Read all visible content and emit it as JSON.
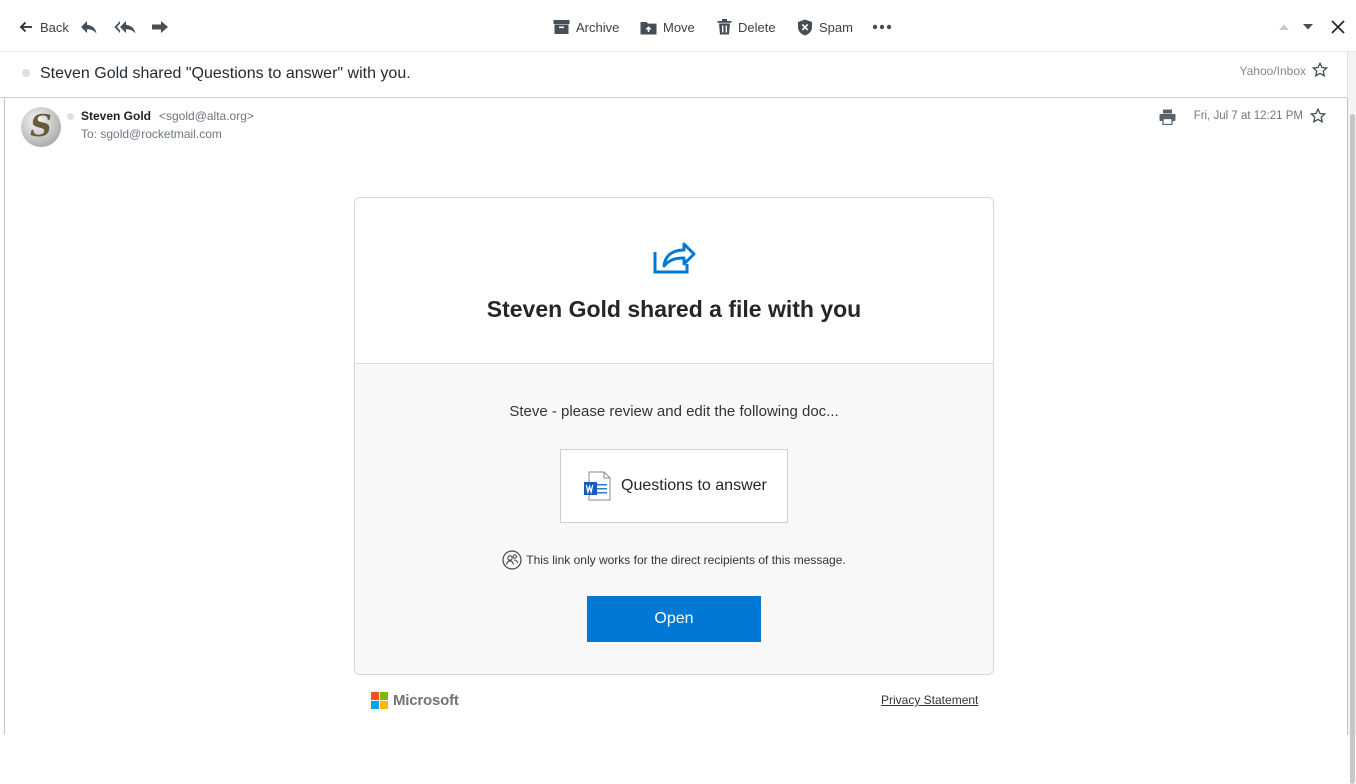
{
  "toolbar": {
    "back_label": "Back",
    "archive_label": "Archive",
    "move_label": "Move",
    "delete_label": "Delete",
    "spam_label": "Spam"
  },
  "subject": {
    "text": "Steven Gold shared \"Questions to answer\" with you.",
    "folder": "Yahoo/Inbox"
  },
  "message": {
    "avatar_letter": "S",
    "sender_name": "Steven Gold",
    "sender_email": "<sgold@alta.org>",
    "to": "To: sgold@rocketmail.com",
    "date": "Fri, Jul 7 at 12:21 PM"
  },
  "card": {
    "title": "Steven Gold shared a file with you",
    "message": "Steve - please review and edit the following doc...",
    "file_name": "Questions to answer",
    "link_note": "This link only works for the direct recipients of this message.",
    "open_label": "Open"
  },
  "footer": {
    "brand": "Microsoft",
    "privacy_label": "Privacy Statement"
  },
  "colors": {
    "accent": "#0078d4",
    "ms_red": "#f25022",
    "ms_green": "#7fba00",
    "ms_blue": "#00a4ef",
    "ms_yellow": "#ffb900"
  }
}
